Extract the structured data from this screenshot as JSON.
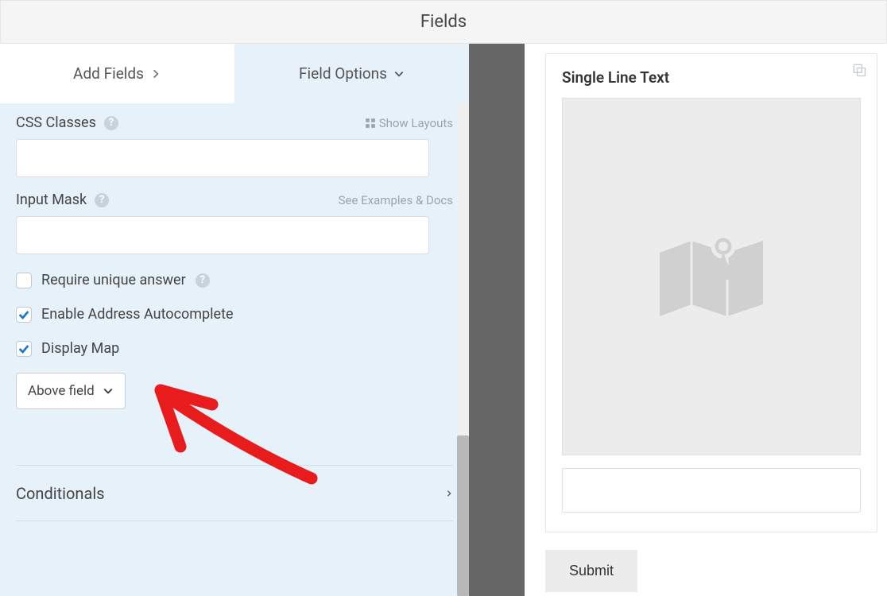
{
  "header": {
    "title": "Fields"
  },
  "tabs": {
    "add_label": "Add Fields",
    "options_label": "Field Options"
  },
  "options": {
    "css_classes": {
      "label": "CSS Classes",
      "show_layouts": "Show Layouts",
      "value": ""
    },
    "input_mask": {
      "label": "Input Mask",
      "docs_link": "See Examples & Docs",
      "value": ""
    },
    "unique": {
      "label": "Require unique answer",
      "checked": false
    },
    "autocomplete": {
      "label": "Enable Address Autocomplete",
      "checked": true
    },
    "display_map": {
      "label": "Display Map",
      "checked": true
    },
    "map_position": {
      "value": "Above field"
    },
    "conditionals": {
      "label": "Conditionals"
    }
  },
  "preview": {
    "title": "Single Line Text",
    "submit_label": "Submit"
  }
}
